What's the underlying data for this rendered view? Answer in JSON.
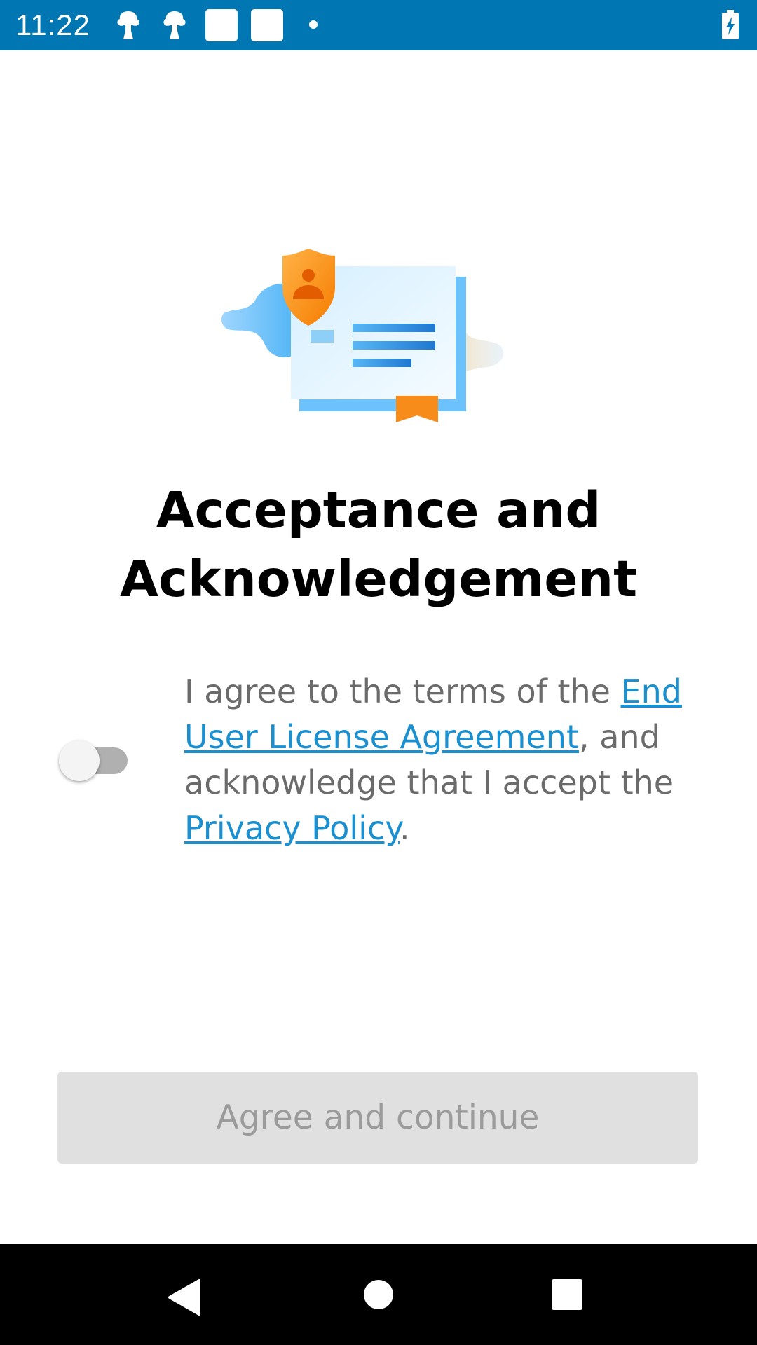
{
  "status_bar": {
    "time": "11:22",
    "icons": [
      "notification-icon",
      "notification-icon",
      "square-notification-icon",
      "square-notification-icon",
      "dot-icon",
      "battery-charging-icon"
    ],
    "color": "#0077b3"
  },
  "illustration": {
    "icon": "certificate-shield-icon"
  },
  "title": {
    "line1": "Acceptance and",
    "line2": "Acknowledgement"
  },
  "agreement": {
    "toggle_state": "off",
    "text_part1": "I agree to the terms of the ",
    "eula_link": "End User License Agreement",
    "text_part2": ", and acknowledge that I accept the ",
    "privacy_link": "Privacy Policy",
    "text_part3": ".",
    "link_color": "#1a90d0"
  },
  "button": {
    "label": "Agree and continue",
    "enabled": false
  },
  "nav_bar": {
    "back": "back-icon",
    "home": "home-icon",
    "recents": "recents-icon"
  }
}
